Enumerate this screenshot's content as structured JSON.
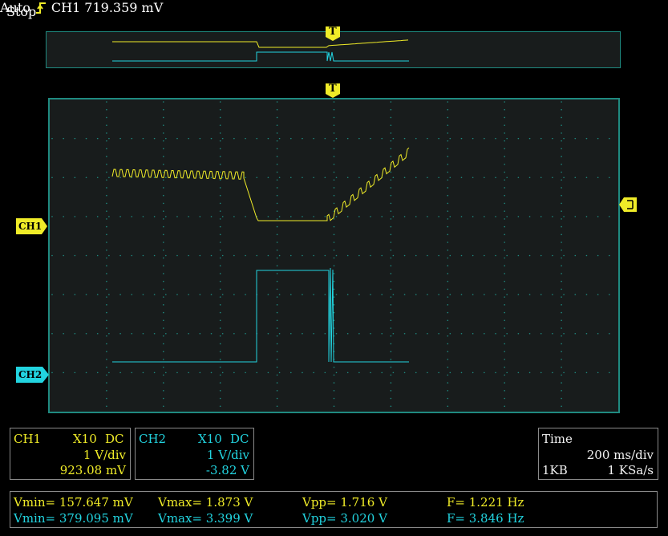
{
  "status": {
    "state": "Stop",
    "trigger_mode": "Auto",
    "trigger_source": "CH1",
    "trigger_level": "719.359 mV"
  },
  "markers": {
    "trigger": "T",
    "ch1": "CH1",
    "ch2": "CH2"
  },
  "ch1_settings": {
    "name": "CH1",
    "probe": "X10",
    "coupling": "DC",
    "scale": "1 V/div",
    "offset": "923.08 mV"
  },
  "ch2_settings": {
    "name": "CH2",
    "probe": "X10",
    "coupling": "DC",
    "scale": "1 V/div",
    "offset": "-3.82 V"
  },
  "time_settings": {
    "label": "Time",
    "scale": "200 ms/div",
    "memory": "1KB",
    "sample_rate": "1 KSa/s"
  },
  "measurements": {
    "ch1": {
      "vmin": "Vmin= 157.647 mV",
      "vmax": "Vmax= 1.873 V",
      "vpp": "Vpp= 1.716 V",
      "freq": "F= 1.221 Hz"
    },
    "ch2": {
      "vmin": "Vmin= 379.095 mV",
      "vmax": "Vmax= 3.399 V",
      "vpp": "Vpp= 3.020 V",
      "freq": "F= 3.846 Hz"
    }
  },
  "colors": {
    "ch1": "#f0ec28",
    "ch2": "#22d4e0",
    "grid_border": "#1f8a80",
    "screen_bg": "#181c1c"
  }
}
